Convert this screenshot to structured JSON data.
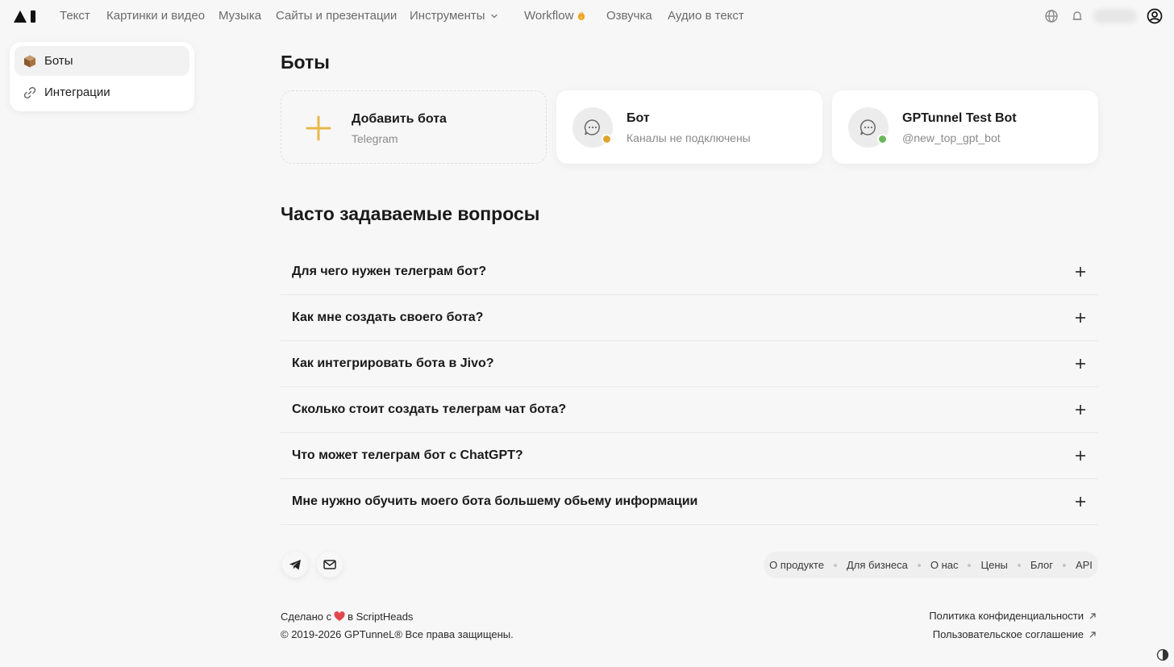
{
  "nav": {
    "items": [
      "Текст",
      "Картинки и видео",
      "Музыка",
      "Сайты и презентации",
      "Инструменты",
      "Workflow",
      "Озвучка",
      "Аудио в текст"
    ]
  },
  "sidebar": {
    "items": [
      {
        "label": "Боты",
        "icon": "box-icon",
        "active": true
      },
      {
        "label": "Интеграции",
        "icon": "link-icon",
        "active": false
      }
    ]
  },
  "main": {
    "title": "Боты",
    "cards": [
      {
        "title": "Добавить бота",
        "subtitle": "Telegram",
        "icon": "plus-icon"
      },
      {
        "title": "Бот",
        "subtitle": "Каналы не подключены",
        "status_color": "#e0a431"
      },
      {
        "title": "GPTunnel Test Bot",
        "subtitle": "@new_top_gpt_bot",
        "status_color": "#6cb85a"
      }
    ]
  },
  "faq": {
    "title": "Часто задаваемые вопросы",
    "questions": [
      "Для чего нужен телеграм бот?",
      "Как мне создать своего бота?",
      "Как интегрировать бота в Jivo?",
      "Сколько стоит создать телеграм чат бота?",
      "Что может телеграм бот с ChatGPT?",
      "Мне нужно обучить моего бота большему обьему информации"
    ]
  },
  "footer": {
    "links": [
      "О продукте",
      "Для бизнеса",
      "О нас",
      "Цены",
      "Блог",
      "API"
    ],
    "made_prefix": "Сделано с",
    "made_suffix": "в ScriptHeads",
    "copyright": "© 2019-2026 GPTunneL® Все права защищены.",
    "privacy": "Политика конфиденциальности",
    "terms": "Пользовательское соглашение"
  },
  "colors": {
    "accent_plus": "#e8b84a",
    "heart": "#e0474c"
  }
}
